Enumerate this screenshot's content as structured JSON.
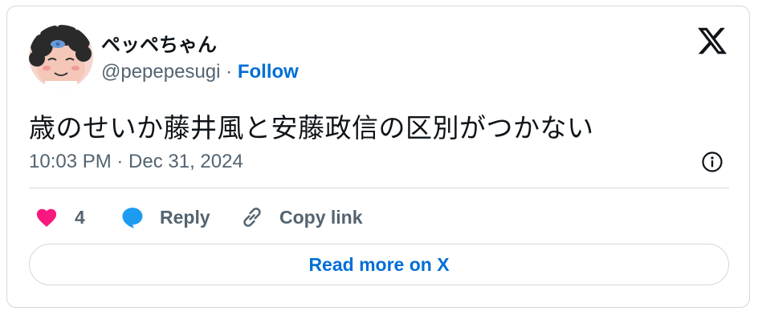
{
  "user": {
    "display_name": "ペッペちゃん",
    "handle": "@pepepesugi",
    "separator": "·",
    "follow_label": "Follow"
  },
  "tweet": {
    "text": "歳のせいか藤井風と安藤政信の区別がつかない",
    "timestamp": "10:03 PM · Dec 31, 2024"
  },
  "actions": {
    "like_count": "4",
    "reply_label": "Reply",
    "copy_label": "Copy link"
  },
  "read_more_label": "Read more on X",
  "colors": {
    "accent": "#006fd6",
    "heart": "#f91880",
    "reply_icon": "#1d9bf0",
    "muted": "#536471",
    "border": "#cfd9de"
  },
  "icons": {
    "brand": "x-logo-icon",
    "info": "info-icon",
    "like": "heart-icon",
    "reply": "speech-bubble-icon",
    "copy": "link-icon"
  }
}
